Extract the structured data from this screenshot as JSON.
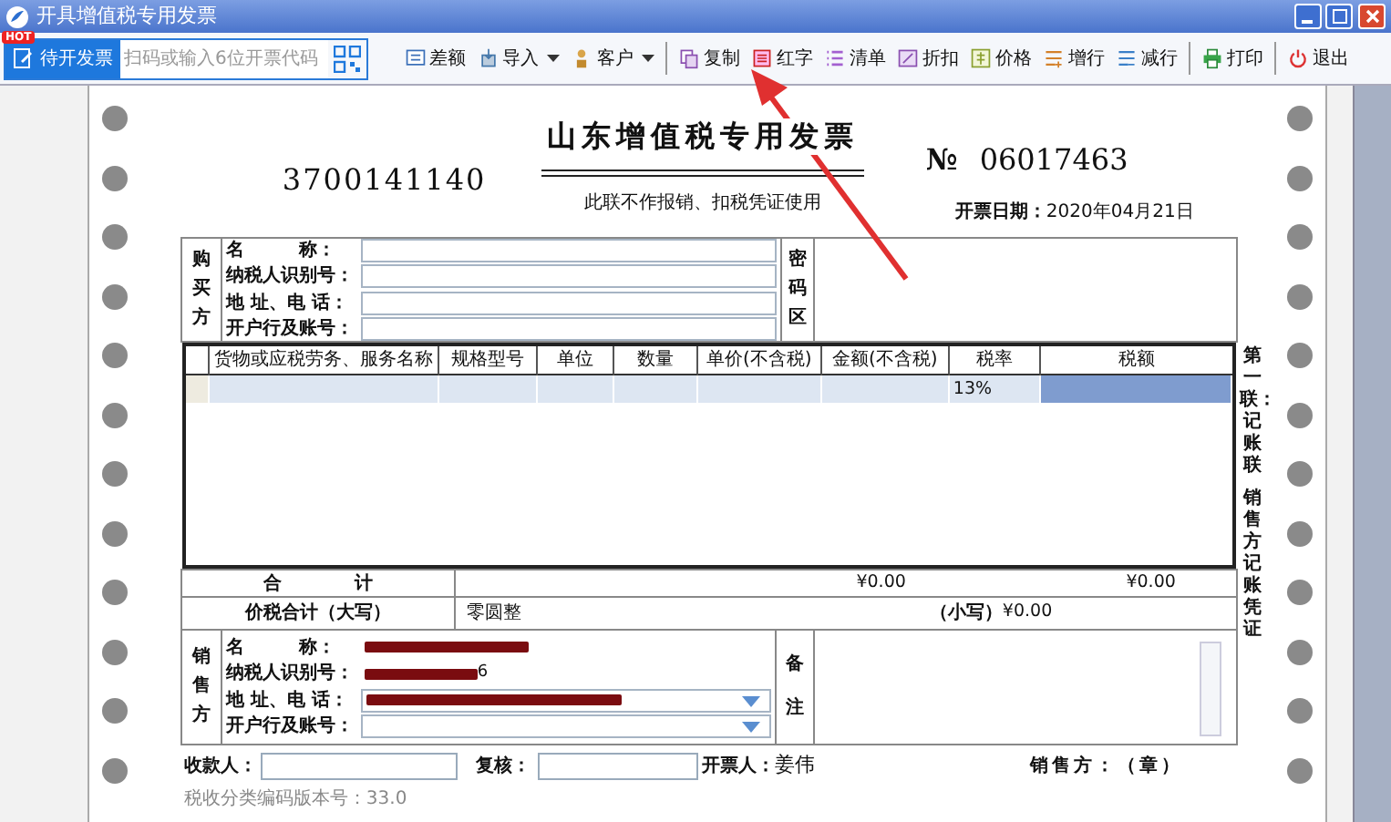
{
  "window": {
    "title": "开具增值税专用发票"
  },
  "toolbar": {
    "pending_button": {
      "label": "待开发票",
      "badge": "HOT"
    },
    "scan_field": {
      "placeholder": "扫码或输入6位开票代码"
    },
    "buttons": [
      {
        "label": "差额",
        "kind": "diff",
        "dropdown": false,
        "separator_before": false
      },
      {
        "label": "导入",
        "kind": "import",
        "dropdown": true,
        "separator_before": false
      },
      {
        "label": "客户",
        "kind": "customer",
        "dropdown": true,
        "separator_before": false
      },
      {
        "label": "复制",
        "kind": "copy",
        "dropdown": false,
        "separator_before": true
      },
      {
        "label": "红字",
        "kind": "red",
        "dropdown": false,
        "separator_before": false
      },
      {
        "label": "清单",
        "kind": "list",
        "dropdown": false,
        "separator_before": false
      },
      {
        "label": "折扣",
        "kind": "discount",
        "dropdown": false,
        "separator_before": false
      },
      {
        "label": "价格",
        "kind": "price",
        "dropdown": false,
        "separator_before": false
      },
      {
        "label": "增行",
        "kind": "addrow",
        "dropdown": false,
        "separator_before": false
      },
      {
        "label": "减行",
        "kind": "delrow",
        "dropdown": false,
        "separator_before": false
      },
      {
        "label": "打印",
        "kind": "print",
        "dropdown": false,
        "separator_before": true
      },
      {
        "label": "退出",
        "kind": "exit",
        "dropdown": false,
        "separator_before": true
      }
    ]
  },
  "invoice": {
    "code": "3700141140",
    "title": "山东增值税专用发票",
    "number_sign": "№",
    "number": "06017463",
    "notice": "此联不作报销、扣税凭证使用",
    "date_label": "开票日期：",
    "date": "2020年04月21日",
    "buyer": {
      "section_label": "购买方",
      "fields": [
        {
          "label": "名　　　称："
        },
        {
          "label": "纳税人识别号："
        },
        {
          "label": "地 址、电 话："
        },
        {
          "label": "开户行及账号："
        }
      ],
      "cipher_label": "密码区"
    },
    "items": {
      "columns": [
        "货物或应税劳务、服务名称",
        "规格型号",
        "单位",
        "数量",
        "单价(不含税)",
        "金额(不含税)",
        "税率",
        "税额"
      ],
      "rows": [
        {
          "tax_rate": "13%",
          "tax_cell_selected": true
        }
      ]
    },
    "total": {
      "label": "合　　　　计",
      "amount": "¥0.00",
      "tax": "¥0.00"
    },
    "grand_total": {
      "label": "价税合计（大写）",
      "in_words": "零圆整",
      "small_label": "（小写）",
      "amount": "¥0.00"
    },
    "seller": {
      "section_label": "销售方",
      "fields": [
        {
          "label": "名　　　称：",
          "kind": "text",
          "redacted": true
        },
        {
          "label": "纳税人识别号：",
          "kind": "text",
          "redacted": true,
          "visible_tail": "6"
        },
        {
          "label": "地 址、电 话：",
          "kind": "dropdown",
          "redacted": true
        },
        {
          "label": "开户行及账号：",
          "kind": "dropdown",
          "redacted": false
        }
      ],
      "remarks_label": "备注"
    },
    "signatures": {
      "payee_label": "收款人：",
      "reviewer_label": "复核：",
      "drawer_label": "开票人：",
      "drawer": "姜伟",
      "seller_seal": "销售方：（章）"
    },
    "copy_label": [
      "第一联：记账联",
      "销售方记账凭证"
    ],
    "version": "税收分类编码版本号：33.0"
  }
}
